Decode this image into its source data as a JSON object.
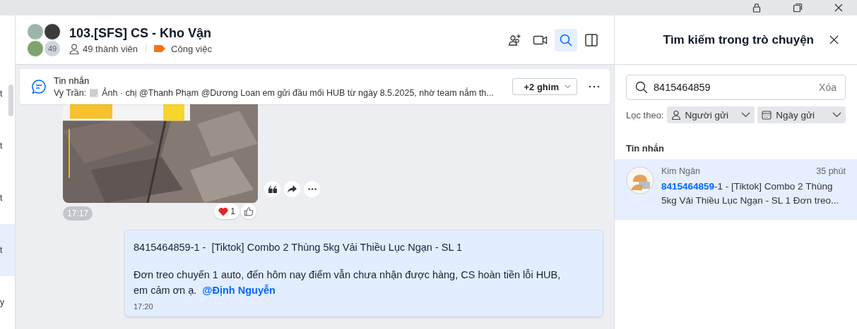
{
  "left_list": [
    {
      "text": "t",
      "selected": false
    },
    {
      "text": "t",
      "selected": false
    },
    {
      "text": "t",
      "selected": false
    },
    {
      "text": "t",
      "selected": true
    },
    {
      "text": "y",
      "selected": false
    }
  ],
  "chat": {
    "title": "103.[SFS] CS - Kho Vận",
    "avatar_count": "49",
    "members": "49 thành viên",
    "label": "Công việc"
  },
  "header_actions": [
    {
      "kind": "add-member",
      "selected": false
    },
    {
      "kind": "video",
      "selected": false
    },
    {
      "kind": "search",
      "selected": true
    },
    {
      "kind": "panel",
      "selected": false
    }
  ],
  "pinned": {
    "title": "Tin nhắn",
    "sender": "Vy Trần:",
    "text": "Ảnh · chị @Thanh Phạm @Dương Loan em gửi đầu mối HUB từ ngày 8.5.2025, nhờ team nắm th...",
    "pins_button": "+2 ghim"
  },
  "image_message": {
    "kind": "picture",
    "heart_count": "1",
    "time": "17:17"
  },
  "message": {
    "title": "8415464859-1 -  [Tiktok] Combo 2 Thùng 5kg Vải Thiều Lục Ngạn - SL 1",
    "body": "Đơn treo chuyến 1 auto, đến hôm nay điểm vẫn chưa nhận được hàng, CS hoàn tiền lỗi HUB, em cảm ơn ạ.",
    "mention": "@Định Nguyễn",
    "time": "17:20"
  },
  "search_panel": {
    "title": "Tìm kiếm trong trò chuyện",
    "query": "8415464859",
    "clear": "Xóa",
    "filter_label": "Lọc theo:",
    "filters": [
      {
        "kind": "person",
        "label": "Người gửi"
      },
      {
        "kind": "date",
        "label": "Ngày gửi"
      }
    ],
    "section": "Tin nhắn",
    "results": [
      {
        "sender": "Kim Ngân",
        "time": "35 phút",
        "highlight": "8415464859",
        "text": "-1 - [Tiktok] Combo 2 Thùng 5kg Vải Thiều Lục Ngạn - SL 1 Đơn treo...",
        "selected": true
      }
    ]
  }
}
